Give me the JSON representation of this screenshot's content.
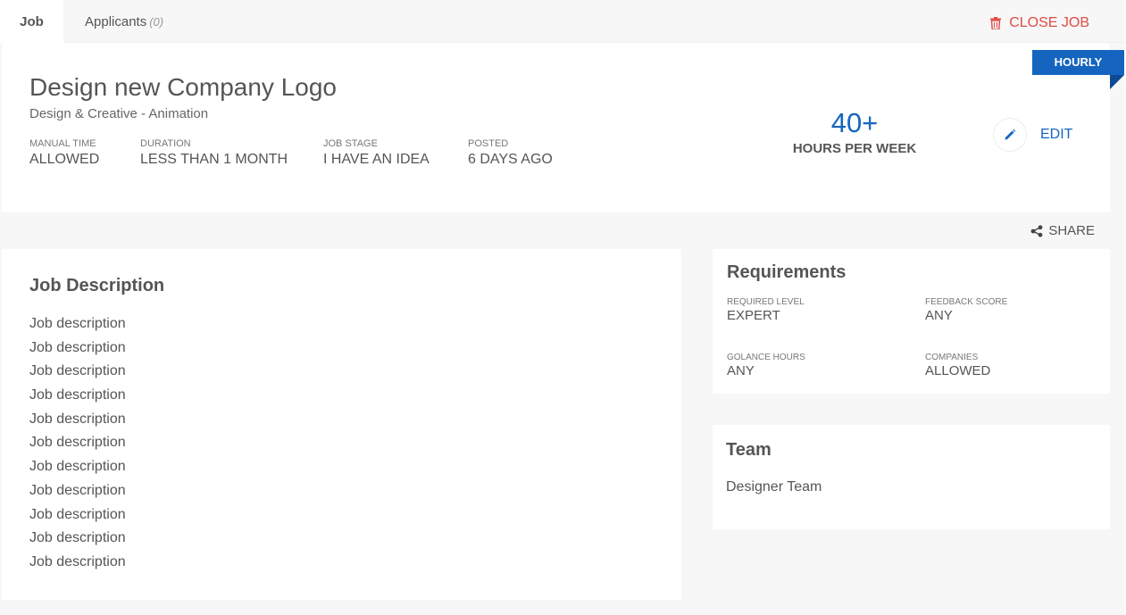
{
  "tabs": [
    {
      "label": "Job"
    },
    {
      "label": "Applicants",
      "count": "(0)"
    }
  ],
  "close_job_label": "CLOSE JOB",
  "badge": "HOURLY",
  "job": {
    "title": "Design new Company Logo",
    "category": "Design & Creative - Animation",
    "meta": [
      {
        "label": "MANUAL TIME",
        "value": "ALLOWED"
      },
      {
        "label": "DURATION",
        "value": "LESS THAN 1 MONTH"
      },
      {
        "label": "JOB STAGE",
        "value": "I HAVE AN IDEA"
      },
      {
        "label": "POSTED",
        "value": "6 DAYS AGO"
      }
    ],
    "hours_value": "40+",
    "hours_unit": "HOURS PER WEEK"
  },
  "edit_label": "EDIT",
  "share_label": "SHARE",
  "description": {
    "title": "Job Description",
    "lines": [
      "Job description",
      "Job description",
      "Job description",
      "Job description",
      "Job description",
      "Job description",
      "Job description",
      "Job description",
      "Job description",
      "Job description",
      "Job description"
    ]
  },
  "requirements": {
    "title": "Requirements",
    "items": [
      {
        "label": "REQUIRED LEVEL",
        "value": "EXPERT"
      },
      {
        "label": "FEEDBACK SCORE",
        "value": "ANY"
      },
      {
        "label": "GOLANCE HOURS",
        "value": "ANY"
      },
      {
        "label": "COMPANIES",
        "value": "ALLOWED"
      }
    ]
  },
  "team": {
    "title": "Team",
    "name": "Designer Team"
  },
  "colors": {
    "accent": "#1565c0",
    "danger": "#e14b45"
  },
  "icons": {
    "close_job": "trash-icon",
    "edit": "pencil-icon",
    "share": "share-icon"
  }
}
